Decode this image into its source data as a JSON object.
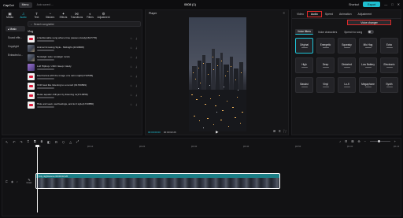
{
  "app": {
    "logo": "CapCut",
    "menu": "Menu",
    "autosave": "Auto saved: ...",
    "project_title": "0808 (1)"
  },
  "header": {
    "shortcut": "Shortcut",
    "export": "Export",
    "minimize": "—",
    "maximize": "□",
    "close": "✕"
  },
  "tools": [
    {
      "label": "Media",
      "icon": "▣"
    },
    {
      "label": "Audio",
      "icon": "♫"
    },
    {
      "label": "Text",
      "icon": "T"
    },
    {
      "label": "Stickers",
      "icon": "◔"
    },
    {
      "label": "Effects",
      "icon": "✦"
    },
    {
      "label": "Transitions",
      "icon": "⋈"
    },
    {
      "label": "Filters",
      "icon": "◐"
    },
    {
      "label": "Adjustment",
      "icon": "⚙"
    }
  ],
  "library": {
    "side_items": [
      "▸ Music",
      "Sound effe...",
      "Copyright",
      "Extracted a..."
    ],
    "search_placeholder": "Search song/artist",
    "section": "Vlog",
    "tracks": [
      {
        "title": "A fashionable song where time passes slowly(1617770)",
        "thumb": "tiktok"
      },
      {
        "title": "Animal Crossing Style - Midnight-(1313808)",
        "thumb": "photo"
      },
      {
        "title": "Nostalgic style nostalgic rondo",
        "thumb": "photo"
      },
      {
        "title": "Lofi Hiphop / chill / sleep / study",
        "thumb": "purple"
      },
      {
        "title": "Electronica with the image of a calm night(1710595)",
        "thumb": "tiktok"
      },
      {
        "title": "Chill beat like listening to a record (61700899)",
        "thumb": "tiktok"
      },
      {
        "title": "Relax aquatic chill jam by listening to(1713858)",
        "thumb": "tiktok"
      },
      {
        "title": "Hide and seek, sad feelings, and lo-fi style(1710856)",
        "thumb": "tiktok"
      }
    ]
  },
  "player": {
    "title": "Player",
    "menu": "≡",
    "current": "00:00:00:00",
    "duration": "00:00:02:26",
    "play": "▶",
    "ctrl_icons": [
      "⊞",
      "⌗",
      "⛶"
    ]
  },
  "right_panel": {
    "tabs": [
      "Video",
      "Audio",
      "Speed",
      "Animation",
      "Adjustment"
    ],
    "active_tab": "Audio",
    "voice_changer": "Voice changer",
    "subtabs": [
      "Voice filters",
      "Voice characters",
      "Speech to song"
    ],
    "effects": [
      "Original",
      "Energetic",
      "Squeaky",
      "Mic Hog",
      "Echo",
      "Low Battery",
      "Deep",
      "Distorted",
      "Lo-Fi",
      "Electronic",
      "Bassist",
      "Vinyl",
      "Lo-Fi",
      "Megaphone",
      "Synth"
    ],
    "effects_display": [
      "Original",
      "Energetic",
      "Squeaky",
      "Mic Hog",
      "Echo",
      "Low",
      "High",
      "Deep",
      "Distorted",
      "Low Battery",
      "Electronic",
      "Bassist",
      "Vinyl",
      "Lo-fi",
      "Megaphone",
      "Synth"
    ]
  },
  "timeline": {
    "tools": [
      "↖",
      "↶",
      "↷",
      "⌶",
      "⧉",
      "⧈",
      "◧",
      "⊡",
      "⬡",
      "△",
      "⤢"
    ],
    "right_tools": [
      "♪",
      "⊟",
      "⊠",
      "⊕",
      "−",
      "+"
    ],
    "ticks": [
      "00:00",
      "|00:10",
      "|00:20",
      "|00:30",
      "|00:40",
      "|00:50",
      "|01:00",
      "|01:10"
    ],
    "cover": "Cover",
    "clip_label": "City nightscene 00:00:02:26"
  }
}
